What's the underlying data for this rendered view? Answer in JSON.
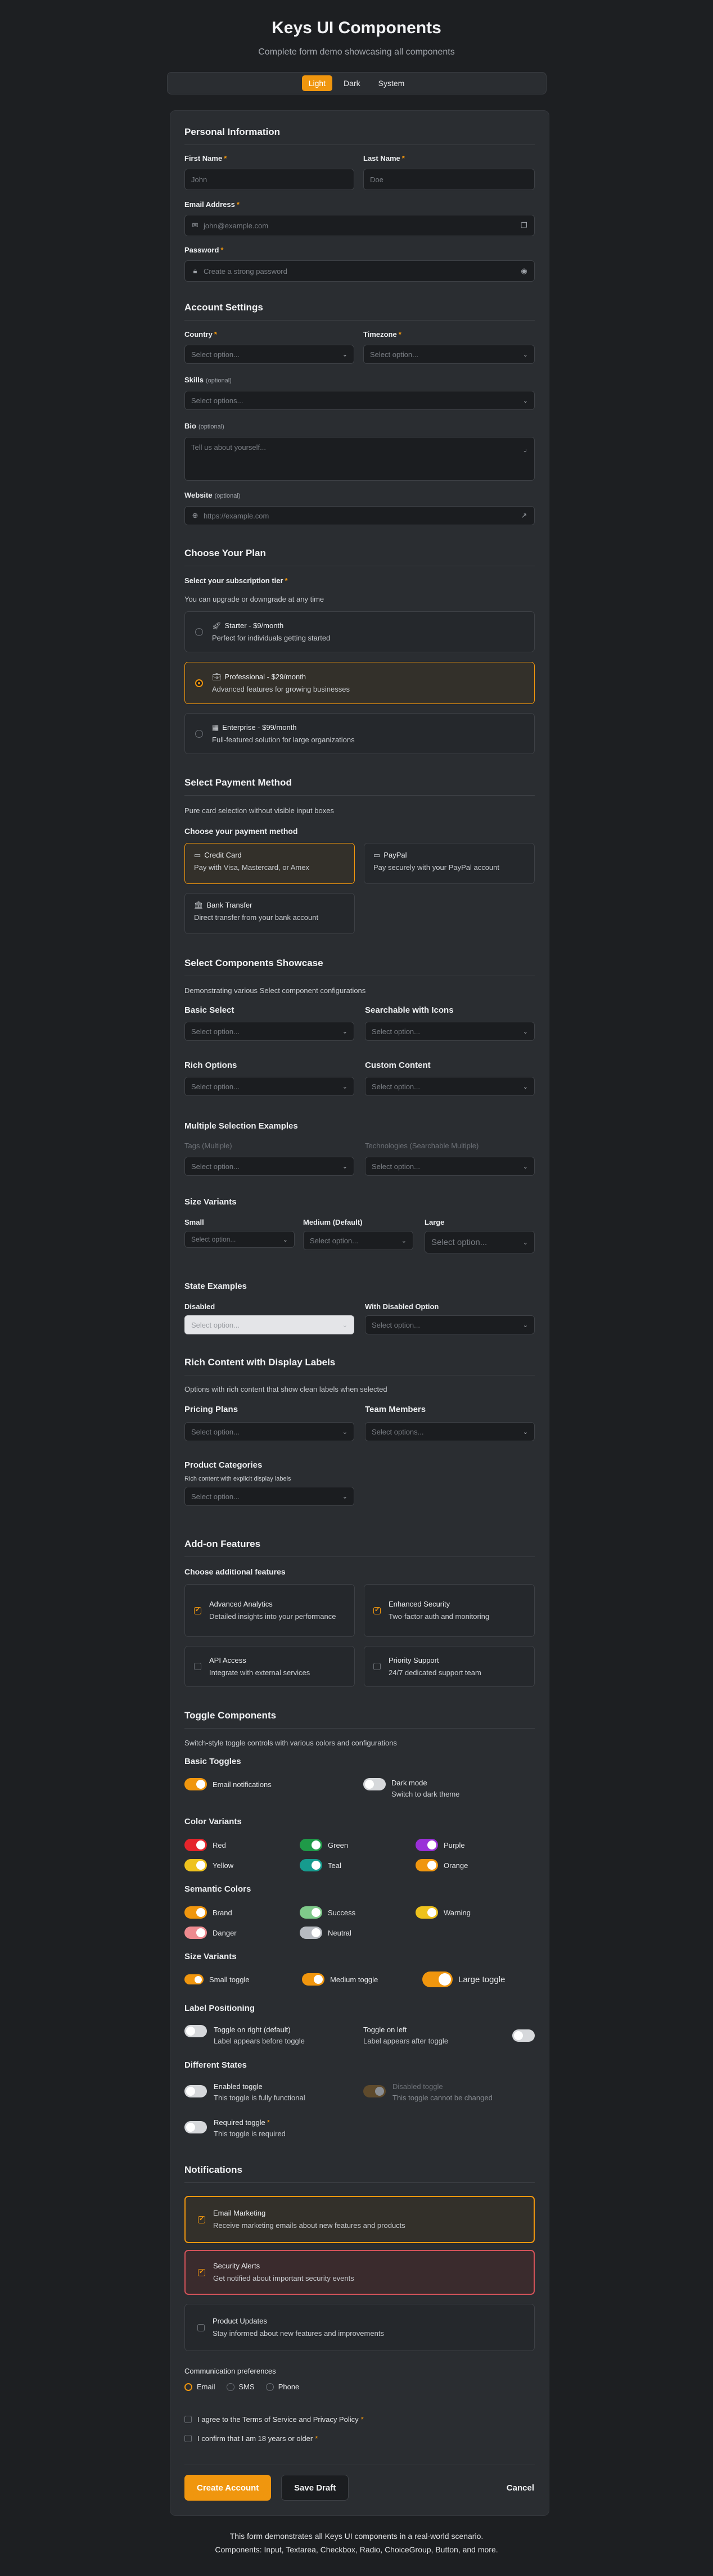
{
  "header": {
    "title": "Keys UI Components",
    "subtitle": "Complete form demo showcasing all components",
    "themes": [
      "Light",
      "Dark",
      "System"
    ]
  },
  "personal": {
    "title": "Personal Information",
    "first_name_label": "First Name",
    "first_name_placeholder": "John",
    "last_name_label": "Last Name",
    "last_name_placeholder": "Doe",
    "email_label": "Email Address",
    "email_placeholder": "john@example.com",
    "password_label": "Password",
    "password_placeholder": "Create a strong password"
  },
  "account": {
    "title": "Account Settings",
    "country_label": "Country",
    "timezone_label": "Timezone",
    "skills_label": "Skills",
    "optional": "(optional)",
    "bio_label": "Bio",
    "bio_placeholder": "Tell us about yourself...",
    "website_label": "Website",
    "website_placeholder": "https://example.com",
    "select_placeholder": "Select option...",
    "select_options_placeholder": "Select options..."
  },
  "plan": {
    "title": "Choose Your Plan",
    "tier_label": "Select your subscription tier",
    "tier_desc": "You can upgrade or downgrade at any time",
    "options": [
      {
        "title": "Starter - $9/month",
        "desc": "Perfect for individuals getting started",
        "icon": "rocket-icon"
      },
      {
        "title": "Professional - $29/month",
        "desc": "Advanced features for growing businesses",
        "icon": "briefcase-icon"
      },
      {
        "title": "Enterprise - $99/month",
        "desc": "Full-featured solution for large organizations",
        "icon": "building-icon"
      }
    ]
  },
  "payment": {
    "title": "Select Payment Method",
    "desc": "Pure card selection without visible input boxes",
    "choose_label": "Choose your payment method",
    "options": [
      {
        "title": "Credit Card",
        "desc": "Pay with Visa, Mastercard, or Amex",
        "icon": "credit-card-icon"
      },
      {
        "title": "PayPal",
        "desc": "Pay securely with your PayPal account",
        "icon": "wallet-icon"
      },
      {
        "title": "Bank Transfer",
        "desc": "Direct transfer from your bank account",
        "icon": "bank-icon"
      }
    ]
  },
  "selects": {
    "title": "Select Components Showcase",
    "desc": "Demonstrating various Select component configurations",
    "basic": "Basic Select",
    "searchable": "Searchable with Icons",
    "rich": "Rich Options",
    "custom": "Custom Content",
    "multiple_title": "Multiple Selection Examples",
    "tags": "Tags (Multiple)",
    "technologies": "Technologies (Searchable Multiple)",
    "sizes_title": "Size Variants",
    "small": "Small",
    "medium": "Medium (Default)",
    "large": "Large",
    "state_title": "State Examples",
    "disabled": "Disabled",
    "with_disabled": "With Disabled Option"
  },
  "rich": {
    "title": "Rich Content with Display Labels",
    "desc": "Options with rich content that show clean labels when selected",
    "pricing": "Pricing Plans",
    "team": "Team Members",
    "categories": "Product Categories",
    "categories_desc": "Rich content with explicit display labels"
  },
  "addons": {
    "title": "Add-on Features",
    "choose": "Choose additional features",
    "items": [
      {
        "title": "Advanced Analytics",
        "desc": "Detailed insights into your performance",
        "checked": true
      },
      {
        "title": "Enhanced Security",
        "desc": "Two-factor auth and monitoring",
        "checked": true
      },
      {
        "title": "API Access",
        "desc": "Integrate with external services",
        "checked": false
      },
      {
        "title": "Priority Support",
        "desc": "24/7 dedicated support team",
        "checked": false
      }
    ]
  },
  "toggles": {
    "title": "Toggle Components",
    "desc": "Switch-style toggle controls with various colors and configurations",
    "basic_title": "Basic Toggles",
    "email_notifications": "Email notifications",
    "dark_mode": "Dark mode",
    "dark_mode_desc": "Switch to dark theme",
    "color_title": "Color Variants",
    "colors": [
      {
        "label": "Red",
        "color": "#e5242b"
      },
      {
        "label": "Green",
        "color": "#1f9a48"
      },
      {
        "label": "Purple",
        "color": "#9a2fd8"
      },
      {
        "label": "Yellow",
        "color": "#eec21d"
      },
      {
        "label": "Teal",
        "color": "#169b8e"
      },
      {
        "label": "Orange",
        "color": "#f0960e"
      }
    ],
    "semantic_title": "Semantic Colors",
    "semantic": [
      {
        "label": "Brand",
        "color": "#f0960e"
      },
      {
        "label": "Success",
        "color": "#7fc98a"
      },
      {
        "label": "Warning",
        "color": "#eec21d"
      },
      {
        "label": "Danger",
        "color": "#ee8a8f"
      },
      {
        "label": "Neutral",
        "color": "#b7bbc1"
      }
    ],
    "size_title": "Size Variants",
    "small": "Small toggle",
    "medium": "Medium toggle",
    "large": "Large toggle",
    "label_pos_title": "Label Positioning",
    "right_title": "Toggle on right (default)",
    "right_desc": "Label appears before toggle",
    "left_title": "Toggle on left",
    "left_desc": "Label appears after toggle",
    "states_title": "Different States",
    "enabled_title": "Enabled toggle",
    "enabled_desc": "This toggle is fully functional",
    "disabled_title": "Disabled toggle",
    "disabled_desc": "This toggle cannot be changed",
    "required_title": "Required toggle",
    "required_desc": "This toggle is required"
  },
  "notifications": {
    "title": "Notifications",
    "items": [
      {
        "title": "Email Marketing",
        "desc": "Receive marketing emails about new features and products"
      },
      {
        "title": "Security Alerts",
        "desc": "Get notified about important security events"
      },
      {
        "title": "Product Updates",
        "desc": "Stay informed about new features and improvements"
      }
    ],
    "comm_label": "Communication preferences",
    "comm_options": [
      "Email",
      "SMS",
      "Phone"
    ],
    "terms": "I agree to the Terms of Service and Privacy Policy",
    "age": "I confirm that I am 18 years or older"
  },
  "actions": {
    "create": "Create Account",
    "draft": "Save Draft",
    "cancel": "Cancel"
  },
  "footer": {
    "line1": "This form demonstrates all Keys UI components in a real-world scenario.",
    "line2": "Components: Input, Textarea, Checkbox, Radio, ChoiceGroup, Button, and more."
  },
  "colors": {
    "accent": "#f0960e",
    "danger_border": "#d4535a",
    "background": "#1d1f22",
    "card": "#2a2d31"
  }
}
